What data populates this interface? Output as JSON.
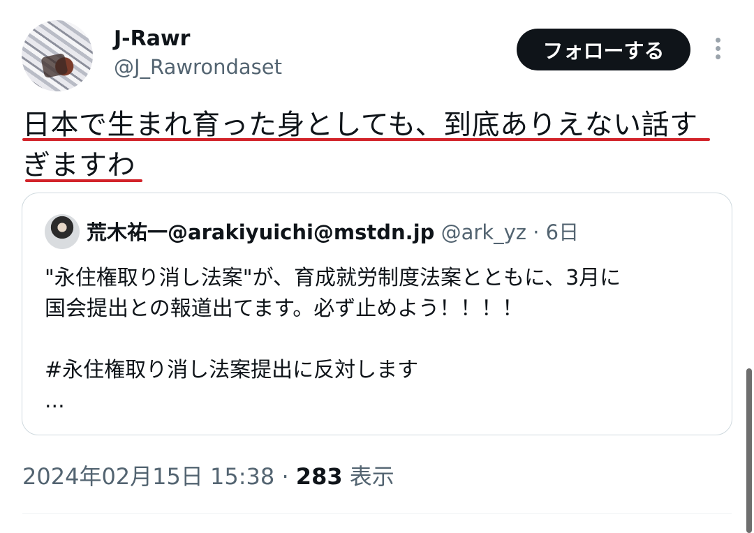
{
  "author": {
    "name": "J-Rawr",
    "handle": "@J_Rawrondaset",
    "avatar_icon": "profile-photo"
  },
  "follow_button": {
    "label": "フォローする"
  },
  "more_icon": "vertical-ellipsis-icon",
  "tweet": {
    "text_line1": "日本で生まれ育った身としても、到底ありえない話す",
    "text_line2": "ぎますわ",
    "underline_color": "#d2232a"
  },
  "quote": {
    "name": "荒木祐一@arakiyuichi@mstdn.jp",
    "handle": "@ark_yz",
    "separator": "·",
    "time": "6日",
    "body": "\"永住権取り消し法案\"が、育成就労制度法案とともに、3月に\n国会提出との報道出てます。必ず止めよう！！！！\n\n#永住権取り消し法案提出に反対します\n..."
  },
  "meta": {
    "datetime": "2024年02月15日 15:38",
    "separator": "·",
    "views_count": "283",
    "views_label": "表示"
  }
}
